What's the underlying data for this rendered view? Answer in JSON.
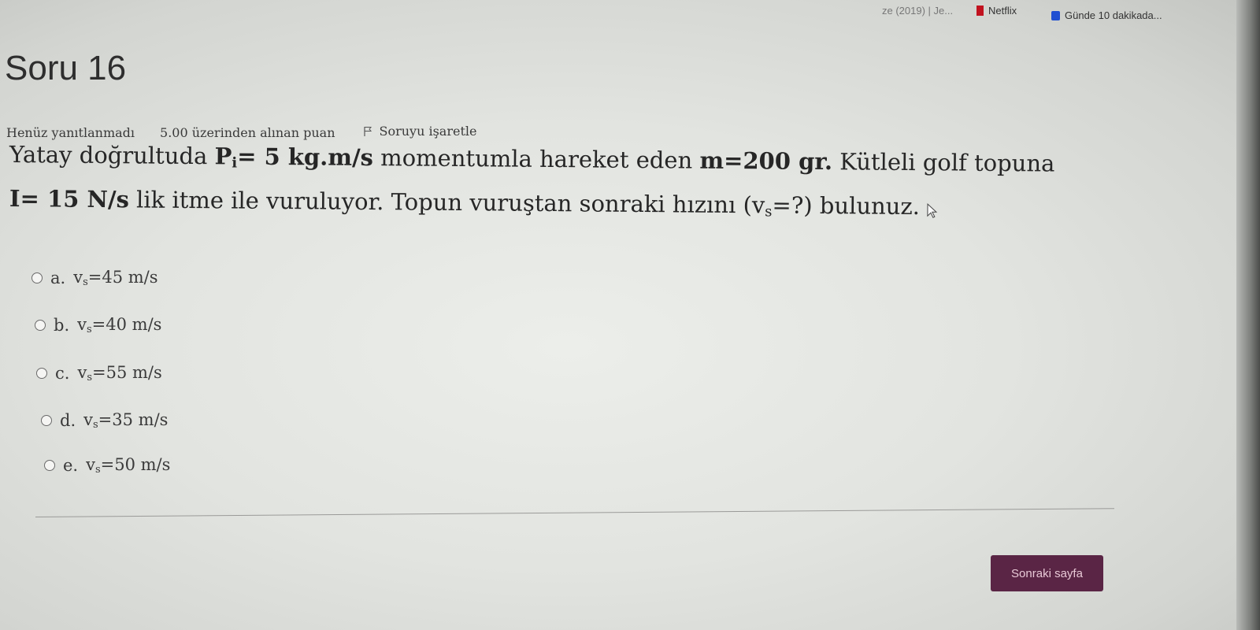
{
  "bookmarks": {
    "previous_label": "ze (2019) | Je...",
    "netflix_label": "Netflix",
    "gunde_label": "Günde 10 dakikada..."
  },
  "question": {
    "title": "Soru 16",
    "status": "Henüz yanıtlanmadı",
    "grade": "5.00 üzerinden alınan puan",
    "flag_label": "Soruyu işaretle",
    "text": {
      "part1": "Yatay doğrultuda ",
      "p_symbol": "P",
      "p_sub": "i",
      "p_value": "= 5 kg.m/s",
      "part2": " momentumla hareket eden ",
      "mass": "m=200 gr.",
      "part3": " Kütleli golf topuna",
      "impulse": "I= 15 N/s",
      "part4": " lik itme ile vuruluyor. Topun vuruştan sonraki hızını (v",
      "v_sub": "s",
      "part5": "=?) bulunuz."
    }
  },
  "answers": [
    {
      "letter": "a.",
      "v": "v",
      "sub": "s",
      "value": "=45 m/s"
    },
    {
      "letter": "b.",
      "v": "v",
      "sub": "s",
      "value": "=40 m/s"
    },
    {
      "letter": "c.",
      "v": "v",
      "sub": "s",
      "value": "=55 m/s"
    },
    {
      "letter": "d.",
      "v": "v",
      "sub": "s",
      "value": "=35 m/s"
    },
    {
      "letter": "e.",
      "v": "v",
      "sub": "s",
      "value": "=50 m/s"
    }
  ],
  "navigation": {
    "next_label": "Sonraki sayfa"
  },
  "colors": {
    "next_button_bg": "#5a2545",
    "netflix_red": "#c1121f",
    "bookmark_blue": "#1f4fd1"
  },
  "icons": {
    "flag": "flag-icon",
    "cursor": "mouse-cursor-icon"
  }
}
